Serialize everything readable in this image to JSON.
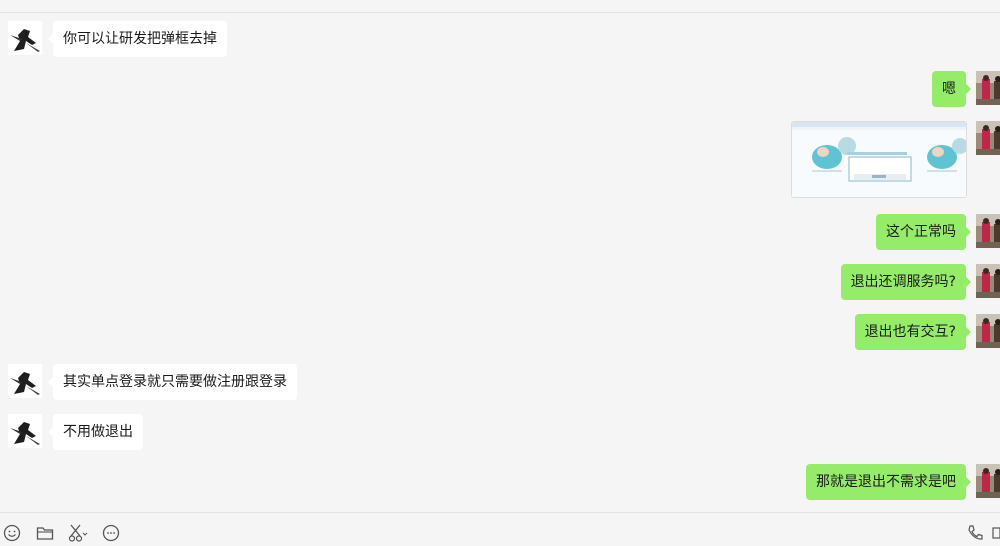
{
  "messages": [
    {
      "side": "in",
      "text": "你可以让研发把弹框去掉"
    },
    {
      "side": "out",
      "text": "嗯"
    },
    {
      "side": "out",
      "type": "image"
    },
    {
      "side": "out",
      "text": "这个正常吗"
    },
    {
      "side": "out",
      "text": "退出还调服务吗?"
    },
    {
      "side": "out",
      "text": "退出也有交互?"
    },
    {
      "side": "in",
      "text": "其实单点登录就只需要做注册跟登录"
    },
    {
      "side": "in",
      "text": "不用做退出"
    },
    {
      "side": "out",
      "text": "那就是退出不需求是吧"
    }
  ],
  "colors": {
    "incoming_bubble": "#ffffff",
    "outgoing_bubble": "#95ec69",
    "background": "#f5f5f5"
  },
  "toolbar": {
    "left_icons": [
      "emoji-icon",
      "folder-icon",
      "scissors-icon",
      "chat-bubble-icon"
    ],
    "right_icons": [
      "phone-icon",
      "video-icon"
    ]
  }
}
